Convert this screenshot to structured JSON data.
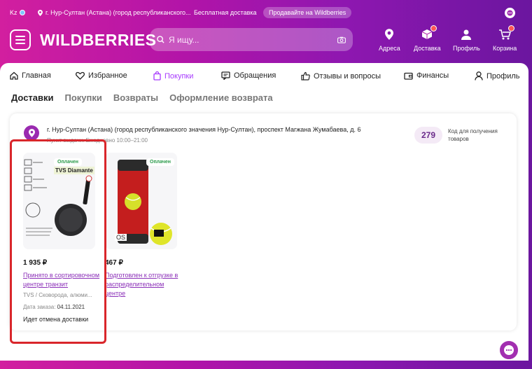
{
  "topbar": {
    "lang": "Kz",
    "city": "г. Нур-Султан (Астана) (город республиканского...",
    "free_shipping": "Бесплатная доставка",
    "sell": "Продавайте на Wildberries"
  },
  "header": {
    "logo": "WILDBERRIES",
    "search_placeholder": "Я ищу...",
    "nav": [
      {
        "label": "Адреса",
        "icon": "map-pin-icon"
      },
      {
        "label": "Доставка",
        "icon": "box-icon"
      },
      {
        "label": "Профиль",
        "icon": "user-icon"
      },
      {
        "label": "Корзина",
        "icon": "cart-icon"
      }
    ]
  },
  "tabs": [
    {
      "label": "Главная",
      "icon": "home-icon"
    },
    {
      "label": "Избранное",
      "icon": "heart-icon"
    },
    {
      "label": "Покупки",
      "icon": "bag-icon"
    },
    {
      "label": "Обращения",
      "icon": "message-icon"
    },
    {
      "label": "Отзывы и вопросы",
      "icon": "thumbs-up-icon"
    },
    {
      "label": "Финансы",
      "icon": "wallet-icon"
    },
    {
      "label": "Профиль",
      "icon": "user-icon"
    }
  ],
  "subtabs": [
    "Доставки",
    "Покупки",
    "Возвраты",
    "Оформление возврата"
  ],
  "delivery": {
    "address": "г. Нур-Султан (Астана) (город республиканского значения Нур-Султан), проспект Магжана Жумабаева, д. 6",
    "hours": "Пункт выдачи. Ежедневно 10:00–21:00",
    "code": "279",
    "code_label": "Код для получения товаров"
  },
  "products": [
    {
      "paid": "Оплачен",
      "brand": "TVS Diamante",
      "price": "1 935 ₽",
      "status": "Принято в сортировочном центре транзит",
      "desc": "TVS / Сковорода, алюми...",
      "date_label": "Дата заказа:",
      "date": "04.11.2021",
      "cancel": "Идет отмена доставки"
    },
    {
      "paid": "Оплачен",
      "price": "467 ₽",
      "status": "Подготовлен к отгрузке в распределительном центре",
      "img_text": "OS"
    }
  ]
}
